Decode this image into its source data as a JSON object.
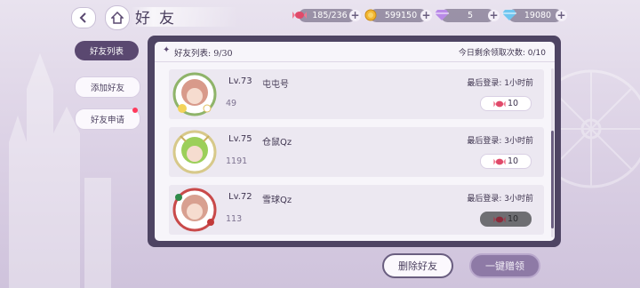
{
  "header": {
    "title": "好友",
    "resources": [
      {
        "icon": "candy-icon",
        "value": "185/236"
      },
      {
        "icon": "gold-coin-icon",
        "value": "599150"
      },
      {
        "icon": "purple-diamond-icon",
        "value": "5"
      },
      {
        "icon": "blue-diamond-icon",
        "value": "19080"
      }
    ]
  },
  "sidebar": {
    "tabs": [
      {
        "label": "好友列表",
        "active": true
      },
      {
        "label": "添加好友",
        "active": false
      },
      {
        "label": "好友申请",
        "active": false
      }
    ]
  },
  "panel": {
    "count_label": "好友列表: 9/30",
    "remaining_label": "今日剩余领取次数: 0/10",
    "friends": [
      {
        "level": "Lv.73",
        "name": "屯屯号",
        "last_login": "最后登录: 1小时前",
        "id": "49",
        "gift": "10",
        "gift_claimed": false
      },
      {
        "level": "Lv.75",
        "name": "仓鼠Qz",
        "last_login": "最后登录: 3小时前",
        "id": "1191",
        "gift": "10",
        "gift_claimed": false
      },
      {
        "level": "Lv.72",
        "name": "雪球Qz",
        "last_login": "最后登录: 3小时前",
        "id": "113",
        "gift": "10",
        "gift_claimed": true
      }
    ]
  },
  "actions": {
    "delete_label": "删除好友",
    "claim_label": "一键赠领"
  },
  "colors": {
    "accent": "#5a4870",
    "panel_frame": "#4e4463",
    "badge_dot": "#ff3a5c"
  }
}
